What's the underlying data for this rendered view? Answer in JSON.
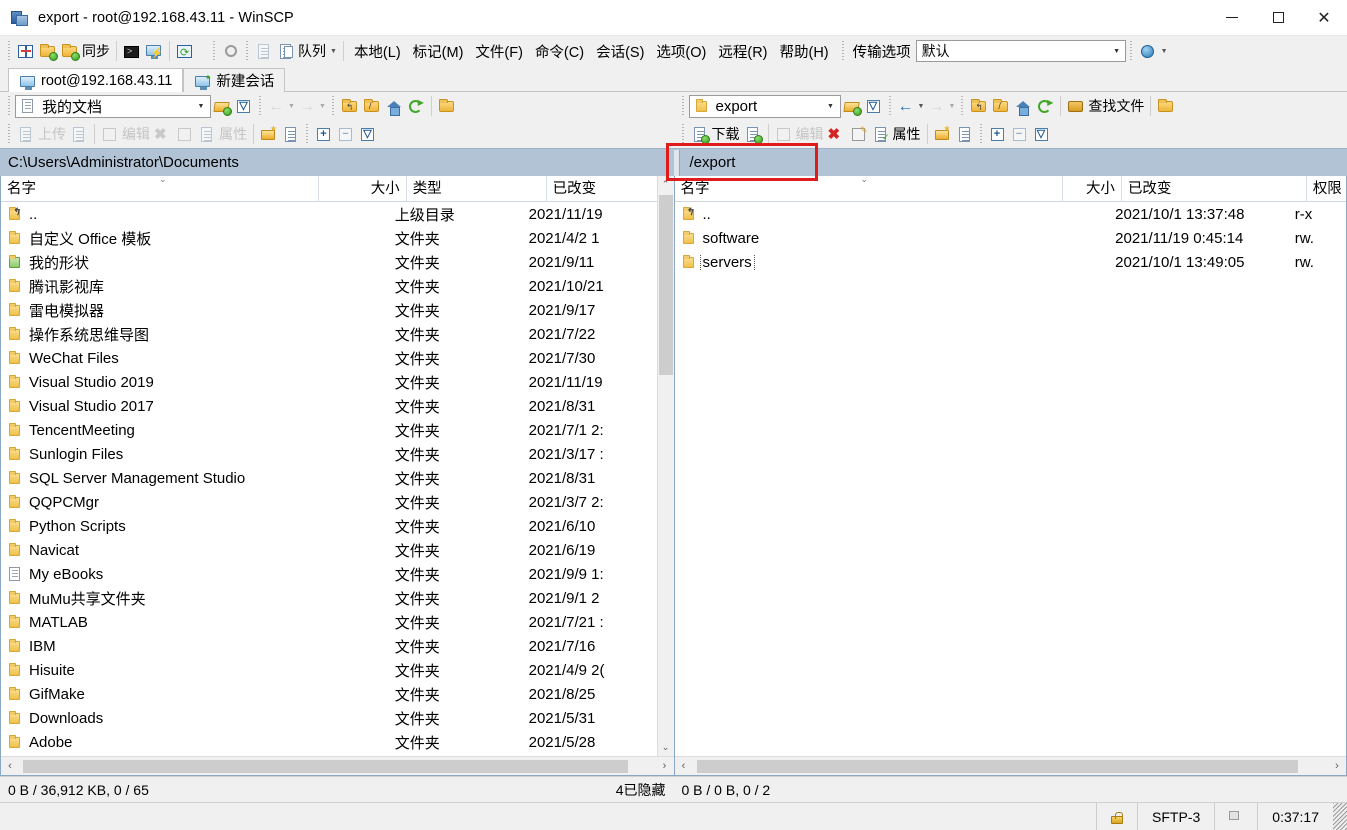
{
  "window": {
    "title": "export - root@192.168.43.11 - WinSCP",
    "app_icon": "winscp-icon",
    "minimize": "–",
    "maximize": "□",
    "close": "✕"
  },
  "toolbar": {
    "sync_label": "同步",
    "queue_label": "队列",
    "transfer_options_label": "传输选项",
    "transfer_options_value": "默认",
    "icons": [
      "split-panes-icon",
      "sync-browsing-icon",
      "synchronize-icon",
      "console-icon",
      "putty-icon",
      "refresh-icon",
      "preferences-icon",
      "queue-list-icon",
      "queue-icon",
      "globe-icon"
    ]
  },
  "menu": {
    "items": [
      {
        "label": "本地(L)"
      },
      {
        "label": "标记(M)"
      },
      {
        "label": "文件(F)"
      },
      {
        "label": "命令(C)"
      },
      {
        "label": "会话(S)"
      },
      {
        "label": "选项(O)"
      },
      {
        "label": "远程(R)"
      },
      {
        "label": "帮助(H)"
      }
    ]
  },
  "tabs": [
    {
      "label": "root@192.168.43.11",
      "icon": "monitor-icon",
      "active": true
    },
    {
      "label": "新建会话",
      "icon": "new-session-icon",
      "active": false
    }
  ],
  "left_panel": {
    "combo_value": "我的文档",
    "path": "C:\\Users\\Administrator\\Documents",
    "toolbar_buttons": [
      {
        "label": "上传",
        "enabled": false
      },
      {
        "label": "编辑",
        "enabled": false
      },
      {
        "label": "属性",
        "enabled": false
      }
    ],
    "columns": [
      {
        "label": "名字",
        "align": "left"
      },
      {
        "label": "大小",
        "align": "right"
      },
      {
        "label": "类型",
        "align": "left"
      },
      {
        "label": "已改变",
        "align": "left"
      }
    ],
    "rows": [
      {
        "name": "..",
        "icon": "parent-folder-icon",
        "size": "",
        "type": "上级目录",
        "changed": "2021/11/19"
      },
      {
        "name": "自定义 Office 模板",
        "icon": "folder-icon",
        "size": "",
        "type": "文件夹",
        "changed": "2021/4/2  1"
      },
      {
        "name": "我的形状",
        "icon": "special-folder-icon",
        "size": "",
        "type": "文件夹",
        "changed": "2021/9/11"
      },
      {
        "name": "腾讯影视库",
        "icon": "folder-icon",
        "size": "",
        "type": "文件夹",
        "changed": "2021/10/21"
      },
      {
        "name": "雷电模拟器",
        "icon": "folder-icon",
        "size": "",
        "type": "文件夹",
        "changed": "2021/9/17"
      },
      {
        "name": "操作系统思维导图",
        "icon": "folder-icon",
        "size": "",
        "type": "文件夹",
        "changed": "2021/7/22"
      },
      {
        "name": "WeChat Files",
        "icon": "folder-icon",
        "size": "",
        "type": "文件夹",
        "changed": "2021/7/30"
      },
      {
        "name": "Visual Studio 2019",
        "icon": "folder-icon",
        "size": "",
        "type": "文件夹",
        "changed": "2021/11/19"
      },
      {
        "name": "Visual Studio 2017",
        "icon": "folder-icon",
        "size": "",
        "type": "文件夹",
        "changed": "2021/8/31"
      },
      {
        "name": "TencentMeeting",
        "icon": "folder-icon",
        "size": "",
        "type": "文件夹",
        "changed": "2021/7/1  2:"
      },
      {
        "name": "Sunlogin Files",
        "icon": "folder-icon",
        "size": "",
        "type": "文件夹",
        "changed": "2021/3/17  :"
      },
      {
        "name": "SQL Server Management Studio",
        "icon": "folder-icon",
        "size": "",
        "type": "文件夹",
        "changed": "2021/8/31"
      },
      {
        "name": "QQPCMgr",
        "icon": "folder-icon",
        "size": "",
        "type": "文件夹",
        "changed": "2021/3/7  2:"
      },
      {
        "name": "Python Scripts",
        "icon": "folder-icon",
        "size": "",
        "type": "文件夹",
        "changed": "2021/6/10"
      },
      {
        "name": "Navicat",
        "icon": "folder-icon",
        "size": "",
        "type": "文件夹",
        "changed": "2021/6/19"
      },
      {
        "name": "My eBooks",
        "icon": "document-folder-icon",
        "size": "",
        "type": "文件夹",
        "changed": "2021/9/9  1:"
      },
      {
        "name": "MuMu共享文件夹",
        "icon": "folder-icon",
        "size": "",
        "type": "文件夹",
        "changed": "2021/9/1  2"
      },
      {
        "name": "MATLAB",
        "icon": "folder-icon",
        "size": "",
        "type": "文件夹",
        "changed": "2021/7/21  :"
      },
      {
        "name": "IBM",
        "icon": "folder-icon",
        "size": "",
        "type": "文件夹",
        "changed": "2021/7/16"
      },
      {
        "name": "Hisuite",
        "icon": "folder-icon",
        "size": "",
        "type": "文件夹",
        "changed": "2021/4/9  2("
      },
      {
        "name": "GifMake",
        "icon": "folder-icon",
        "size": "",
        "type": "文件夹",
        "changed": "2021/8/25"
      },
      {
        "name": "Downloads",
        "icon": "folder-icon",
        "size": "",
        "type": "文件夹",
        "changed": "2021/5/31"
      },
      {
        "name": "Adobe",
        "icon": "folder-icon",
        "size": "",
        "type": "文件夹",
        "changed": "2021/5/28"
      }
    ],
    "status": {
      "transferred": "0 B / 36,912 KB,  0 / 65",
      "hidden": "4已隐藏"
    }
  },
  "right_panel": {
    "combo_value": "export",
    "path": "/export",
    "find_files_label": "查找文件",
    "toolbar_buttons": [
      {
        "label": "下载",
        "enabled": true
      },
      {
        "label": "编辑",
        "enabled": false
      },
      {
        "label": "属性",
        "enabled": true
      }
    ],
    "columns": [
      {
        "label": "名字",
        "align": "left"
      },
      {
        "label": "大小",
        "align": "right"
      },
      {
        "label": "已改变",
        "align": "left"
      },
      {
        "label": "权限",
        "align": "left"
      }
    ],
    "rows": [
      {
        "name": "..",
        "icon": "parent-folder-icon",
        "size": "",
        "changed": "2021/10/1 13:37:48",
        "rights": "r-x",
        "focused": false
      },
      {
        "name": "software",
        "icon": "folder-icon",
        "size": "",
        "changed": "2021/11/19 0:45:14",
        "rights": "rw.",
        "focused": false
      },
      {
        "name": "servers",
        "icon": "folder-icon",
        "size": "",
        "changed": "2021/10/1 13:49:05",
        "rights": "rw.",
        "focused": true
      }
    ],
    "status": {
      "transferred": "0 B / 0 B,  0 / 2"
    }
  },
  "bottom_bar": {
    "lock_icon": "lock-icon",
    "protocol": "SFTP-3",
    "net_icon": "network-icon",
    "elapsed": "0:37:17"
  },
  "colors": {
    "path_bar_bg": "#b2c3d6",
    "annotation_red": "#e01b1b",
    "panel_border": "#8aa8c6",
    "folder_yellow": "#f0c14b"
  }
}
